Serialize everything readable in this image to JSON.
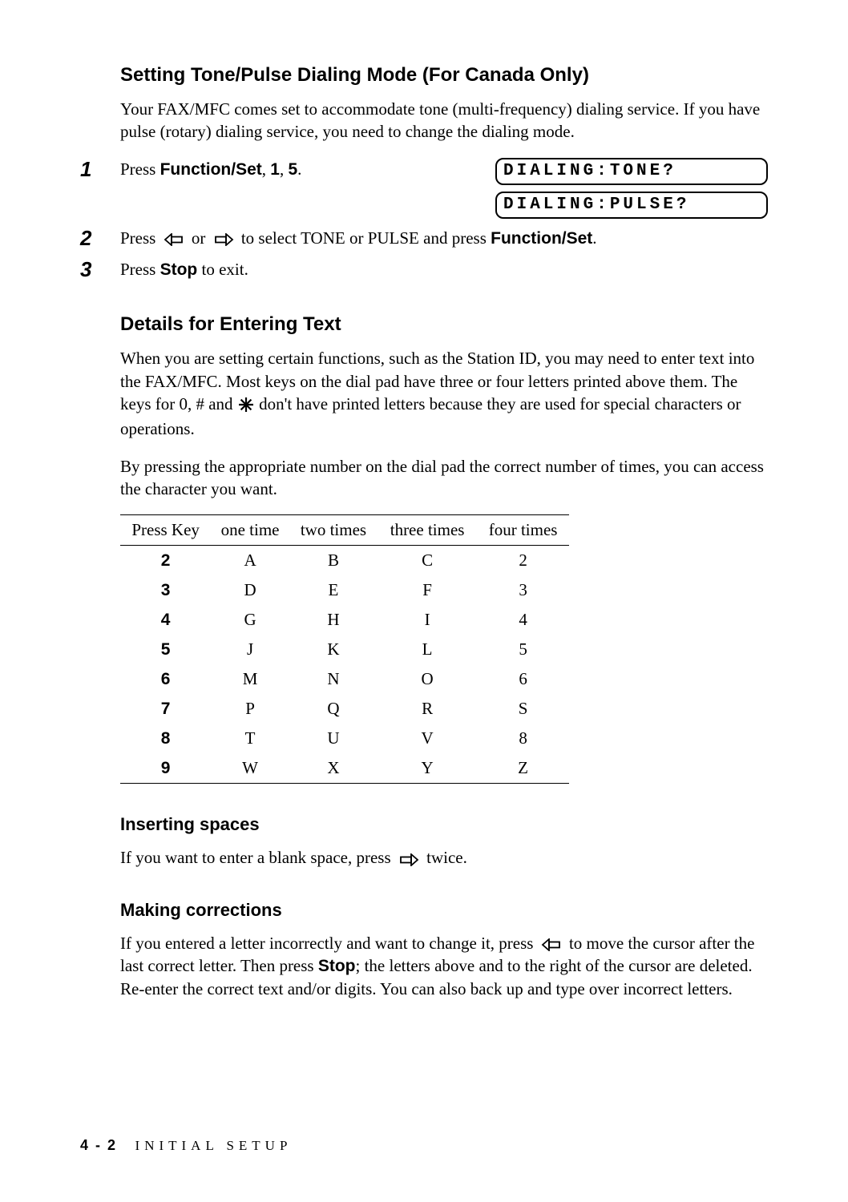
{
  "section1": {
    "heading": "Setting Tone/Pulse Dialing Mode (For Canada Only)",
    "intro": "Your FAX/MFC comes set to accommodate tone (multi-frequency) dialing service. If you have pulse (rotary) dialing service, you need to change the dialing mode.",
    "step1": {
      "num": "1",
      "press": "Press ",
      "fnset": "Function/Set",
      "after_fnset": ", ",
      "one": "1",
      "after_one": ", ",
      "five": "5",
      "period": "."
    },
    "lcd1": "DIALING:TONE?",
    "lcd2": "DIALING:PULSE?",
    "step2": {
      "num": "2",
      "press": "Press ",
      "mid": " or ",
      "tail": " to select TONE or PULSE and press ",
      "fnset": "Function/Set",
      "period": "."
    },
    "step3": {
      "num": "3",
      "press": "Press ",
      "stop": "Stop",
      "tail": " to exit."
    }
  },
  "section2": {
    "heading": "Details for Entering Text",
    "para1_a": "When you are setting certain functions, such as the Station ID, you may need to enter text into the FAX/MFC. Most keys on the dial pad have three or four letters printed above them. The keys for 0, # and ",
    "para1_b": " don't have printed letters because they are used for special characters or operations.",
    "para2": "By pressing the appropriate number on the dial pad the correct number of times, you can access the character you want.",
    "table": {
      "headers": [
        "Press Key",
        "one time",
        "two times",
        "three times",
        "four times"
      ],
      "rows": [
        [
          "2",
          "A",
          "B",
          "C",
          "2"
        ],
        [
          "3",
          "D",
          "E",
          "F",
          "3"
        ],
        [
          "4",
          "G",
          "H",
          "I",
          "4"
        ],
        [
          "5",
          "J",
          "K",
          "L",
          "5"
        ],
        [
          "6",
          "M",
          "N",
          "O",
          "6"
        ],
        [
          "7",
          "P",
          "Q",
          "R",
          "S"
        ],
        [
          "8",
          "T",
          "U",
          "V",
          "8"
        ],
        [
          "9",
          "W",
          "X",
          "Y",
          "Z"
        ]
      ]
    }
  },
  "section3": {
    "heading": "Inserting spaces",
    "text_a": "If you want to enter a blank space, press ",
    "text_b": " twice."
  },
  "section4": {
    "heading": "Making corrections",
    "text_a": "If you entered a letter incorrectly and want to change it, press ",
    "text_b": " to move the cursor after the last correct letter. Then press ",
    "stop": "Stop",
    "text_c": "; the letters above and to the right of the cursor are deleted.  Re-enter the correct text and/or digits. You can also back up and type over incorrect letters."
  },
  "footer": {
    "page": "4 - 2",
    "chapter": "INITIAL SETUP"
  }
}
